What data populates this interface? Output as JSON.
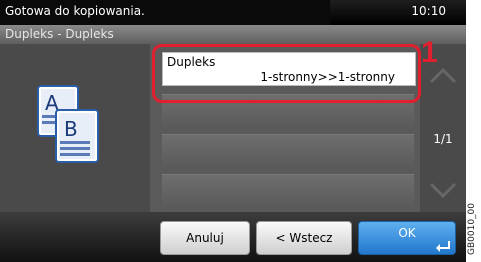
{
  "status": {
    "message": "Gotowa do kopiowania.",
    "time": "10:10"
  },
  "subtitle": "Dupleks - Dupleks",
  "option": {
    "label": "Dupleks",
    "value": "1-stronny>>1-stronny"
  },
  "callout": "1",
  "page_indicator": "1/1",
  "buttons": {
    "cancel": "Anuluj",
    "back": "< Wstecz",
    "ok": "OK"
  },
  "caption": "GB0010_00",
  "colors": {
    "highlight": "#e0202e",
    "ok_button": "#2277cc"
  }
}
